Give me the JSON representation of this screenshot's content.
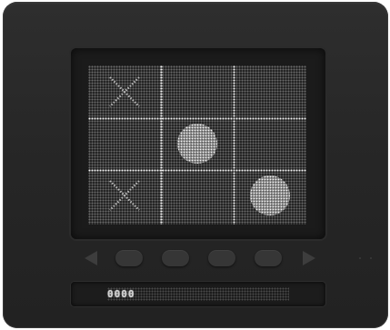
{
  "game": {
    "board": [
      [
        "X",
        "",
        ""
      ],
      [
        "",
        "O",
        ""
      ],
      [
        "X",
        "",
        "O"
      ]
    ],
    "colors": {
      "body": "#2a2a2a",
      "screen": "#1b1b1b",
      "dot_on": "#f2f2f2",
      "dot_off": "#6a6a6a",
      "button": "#363636"
    }
  },
  "controls": {
    "left_arrow_icon": "triangle-left-icon",
    "right_arrow_icon": "triangle-right-icon",
    "buttons": [
      "button-1",
      "button-2",
      "button-3",
      "button-4"
    ]
  },
  "status": {
    "text": "0000"
  }
}
